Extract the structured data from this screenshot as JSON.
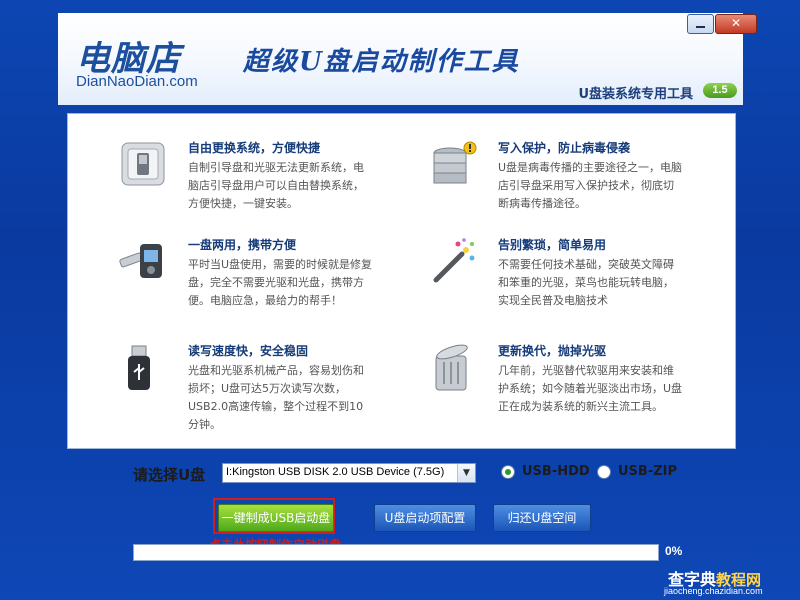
{
  "banner": {
    "logo_cn": "电脑店",
    "logo_en": "DianNaoDian.com",
    "subtitle": "超级U盘启动制作工具",
    "tool_title": "U盘装系统专用工具",
    "version": "1.5"
  },
  "window_controls": {
    "minimize": "",
    "close": "✕"
  },
  "features": [
    {
      "title": "自由更换系统，方便快捷",
      "desc": "自制引导盘和光驱无法更新系统，电脑店引导盘用户可以自由替换系统，方便快捷，一键安装。",
      "icon": "switch-icon"
    },
    {
      "title": "写入保护，防止病毒侵袭",
      "desc": "U盘是病毒传播的主要途径之一，电脑店引导盘采用写入保护技术，彻底切断病毒传播途径。",
      "icon": "database-warning-icon"
    },
    {
      "title": "一盘两用，携带方便",
      "desc": "平时当U盘使用，需要的时候就是修复盘，完全不需要光驱和光盘，携带方便。电脑应急，最给力的帮手！",
      "icon": "usb-device-icon"
    },
    {
      "title": "告别繁琐，简单易用",
      "desc": "不需要任何技术基础，突破英文障碍和笨重的光驱，菜鸟也能玩转电脑，实现全民普及电脑技术",
      "icon": "magic-wand-icon"
    },
    {
      "title": "读写速度快，安全稳固",
      "desc": "光盘和光驱系机械产品，容易划伤和损坏；U盘可达5万次读写次数，USB2.0高速传输，整个过程不到10分钟。",
      "icon": "usb-stick-icon"
    },
    {
      "title": "更新换代，抛掉光驱",
      "desc": "几年前，光驱替代软驱用来安装和维护系统；如今随着光驱淡出市场，U盘正在成为装系统的新兴主流工具。",
      "icon": "trash-can-icon"
    }
  ],
  "select": {
    "label": "请选择U盘",
    "selected_drive": "I:Kingston USB DISK 2.0 USB Device (7.5G)",
    "modes": [
      {
        "label": "USB-HDD",
        "selected": true
      },
      {
        "label": "USB-ZIP",
        "selected": false
      }
    ]
  },
  "buttons": {
    "make": "一键制成USB启动盘",
    "config": "U盘启动项配置",
    "restore": "归还U盘空间"
  },
  "hint": "点击此按钮制作启动磁盘",
  "progress": {
    "value": 0,
    "label": "0%"
  },
  "watermark": {
    "main": "查字典",
    "sub": "教程网",
    "url": "jiaocheng.chazidian.com"
  },
  "colors": {
    "accent_green": "#4fa91b",
    "highlight_red": "#d21d1d",
    "title_blue": "#163c7a"
  }
}
